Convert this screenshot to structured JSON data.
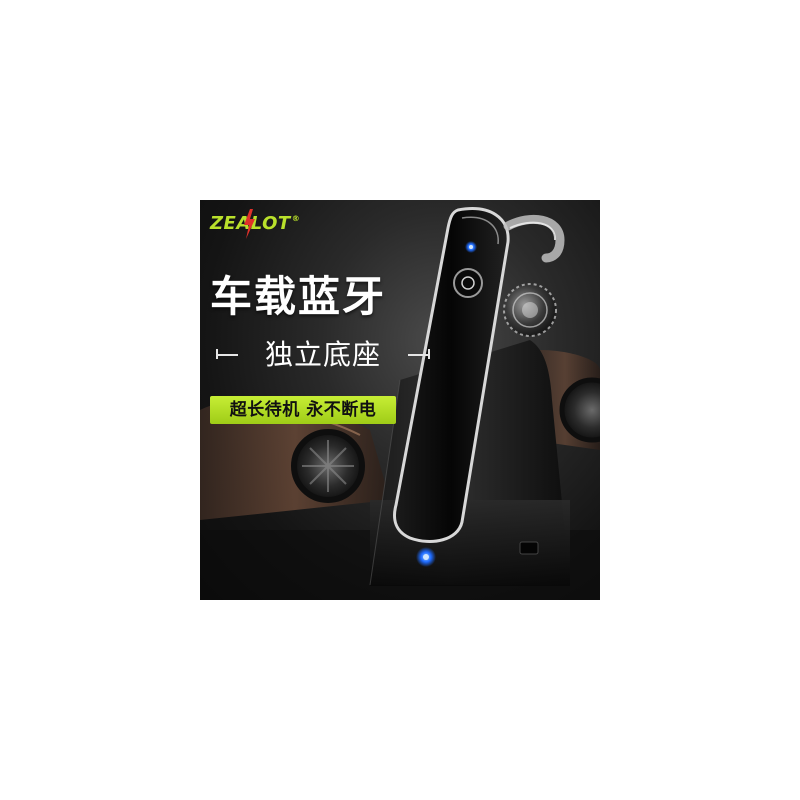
{
  "brand": {
    "logo_text": "ZEALOT",
    "registered_mark": "®"
  },
  "headline": "车载蓝牙",
  "subheadline": "独立底座",
  "badge": "超长待机 永不断电",
  "colors": {
    "accent_green": "#b9e02b",
    "led_blue": "#1e6bff",
    "background": "#141414"
  },
  "icons": [
    "lightning-bolt-icon",
    "registered-mark-icon"
  ]
}
